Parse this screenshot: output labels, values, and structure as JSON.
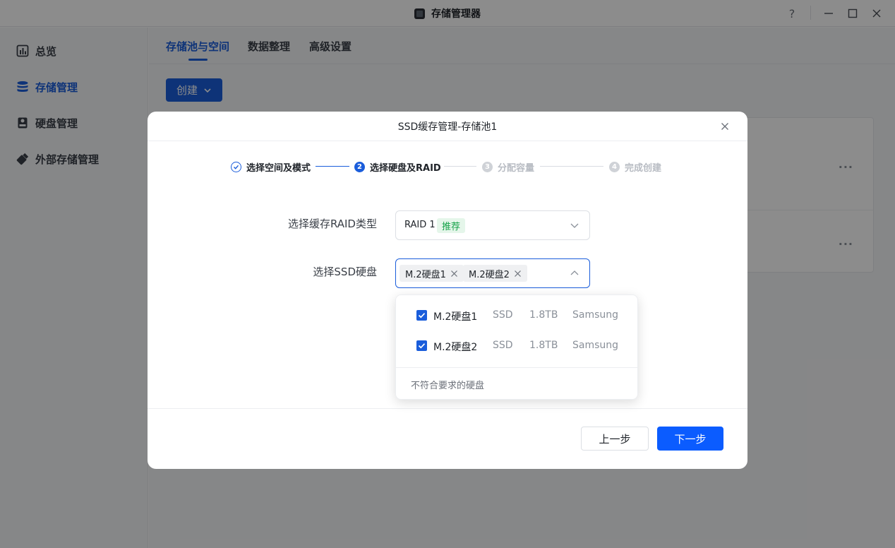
{
  "window": {
    "title": "存储管理器",
    "help_label": "?"
  },
  "sidebar": {
    "items": [
      {
        "label": "总览",
        "icon": "bar-chart-icon",
        "active": false
      },
      {
        "label": "存储管理",
        "icon": "database-icon",
        "active": true
      },
      {
        "label": "硬盘管理",
        "icon": "hard-disk-icon",
        "active": false
      },
      {
        "label": "外部存储管理",
        "icon": "usb-drive-icon",
        "active": false
      }
    ]
  },
  "main": {
    "tabs": [
      {
        "label": "存储池与空间",
        "active": true
      },
      {
        "label": "数据整理",
        "active": false
      },
      {
        "label": "高级设置",
        "active": false
      }
    ],
    "create_label": "创建",
    "more_label": "···"
  },
  "dialog": {
    "title": "SSD缓存管理-存储池1",
    "steps": [
      {
        "num": "1",
        "label": "选择空间及模式",
        "state": "done"
      },
      {
        "num": "2",
        "label": "选择硬盘及RAID",
        "state": "current"
      },
      {
        "num": "3",
        "label": "分配容量",
        "state": "pending"
      },
      {
        "num": "4",
        "label": "完成创建",
        "state": "pending"
      }
    ],
    "raid_label": "选择缓存RAID类型",
    "raid_value": "RAID 1",
    "raid_badge": "推荐",
    "ssd_label": "选择SSD硬盘",
    "ssd_tags": [
      "M.2硬盘1",
      "M.2硬盘2"
    ],
    "dropdown": {
      "options": [
        {
          "name": "M.2硬盘1",
          "type": "SSD",
          "size": "1.8TB",
          "vendor": "Samsung",
          "checked": true
        },
        {
          "name": "M.2硬盘2",
          "type": "SSD",
          "size": "1.8TB",
          "vendor": "Samsung",
          "checked": true
        }
      ],
      "footer": "不符合要求的硬盘"
    },
    "prev_label": "上一步",
    "next_label": "下一步"
  },
  "colors": {
    "accent": "#1a5ddb",
    "primary_button": "#0b5cff",
    "badge_bg": "#e5f6ea",
    "badge_text": "#16a34a"
  }
}
